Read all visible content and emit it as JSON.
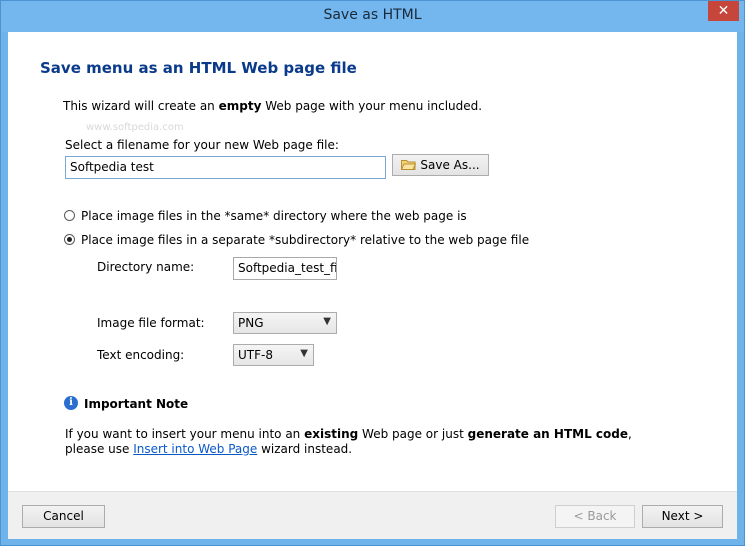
{
  "window": {
    "title": "Save as HTML",
    "close_glyph": "✕"
  },
  "heading": "Save menu as an HTML Web page file",
  "intro": {
    "before": "This wizard will create an ",
    "bold": "empty",
    "after": " Web page with your menu included."
  },
  "watermark": "www.softpedia.com",
  "filename": {
    "label": "Select a filename for your new Web page file:",
    "value": "Softpedia test",
    "save_as_label": "Save As..."
  },
  "placement": {
    "option_same": "Place image files in the *same* directory where the web page is",
    "option_subdir": "Place image files in a separate *subdirectory* relative to the web page file",
    "selected": "subdir"
  },
  "directory": {
    "label": "Directory name:",
    "value": "Softpedia_test_files"
  },
  "image_format": {
    "label": "Image file format:",
    "value": "PNG"
  },
  "text_encoding": {
    "label": "Text encoding:",
    "value": "UTF-8"
  },
  "note": {
    "icon": "info-icon",
    "title": "Important Note",
    "line1_a": "If you want to insert your menu into an ",
    "line1_b": "existing",
    "line1_c": " Web page or just ",
    "line1_d": "generate an HTML code",
    "line1_e": ",",
    "line2_a": "please use ",
    "line2_link": "Insert into Web Page",
    "line2_b": " wizard instead."
  },
  "footer": {
    "cancel_label": "Cancel",
    "back_label": "< Back",
    "next_label": "Next >"
  },
  "colors": {
    "title_bar": "#73b7ee",
    "heading": "#0a3a8a",
    "link": "#0a58c8",
    "close_button": "#c7463c"
  }
}
